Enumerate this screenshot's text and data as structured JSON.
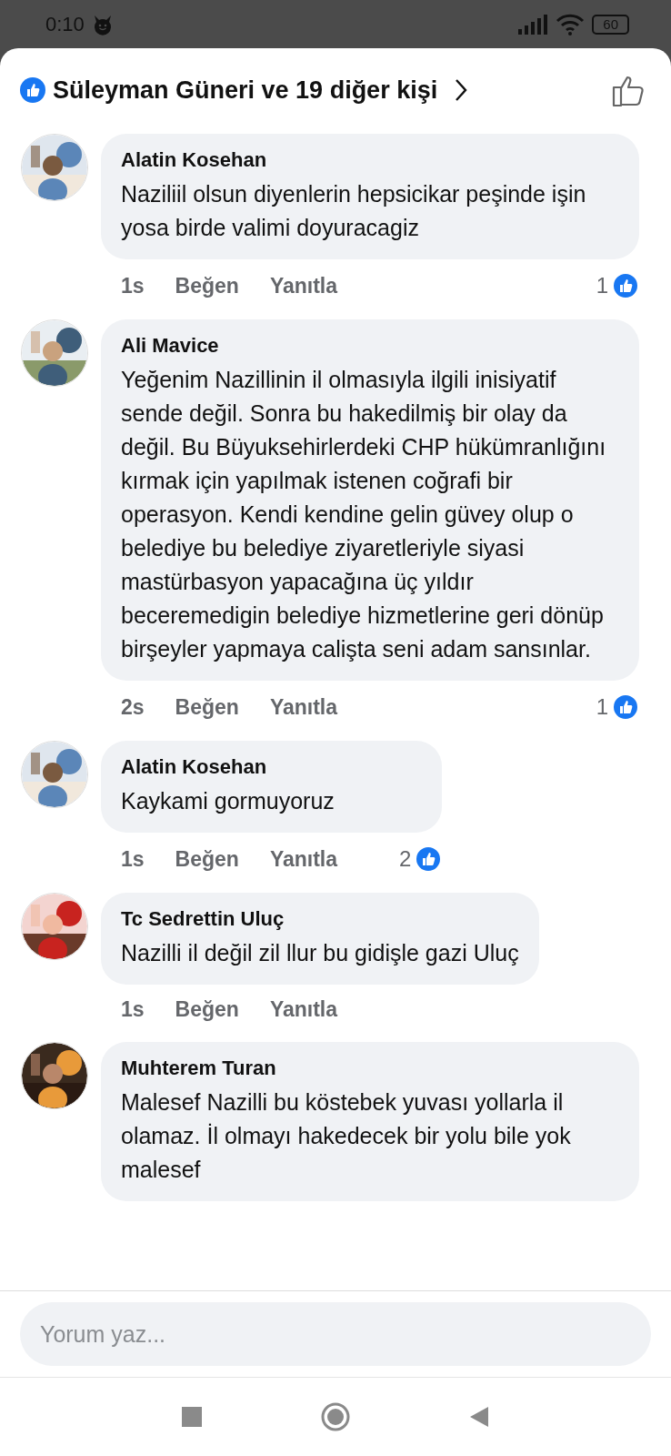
{
  "status_bar": {
    "time": "0:10",
    "battery": "60"
  },
  "header": {
    "title": "Süleyman Güneri ve 19 diğer kişi"
  },
  "comments": [
    {
      "author": "Alatin Kosehan",
      "text": "Naziliil olsun diyenlerin hepsicikar peşinde işin yosa birde valimi doyuracagiz",
      "time": "1s",
      "like_label": "Beğen",
      "reply_label": "Yanıtla",
      "likes": "1"
    },
    {
      "author": "Ali Mavice",
      "text": "Yeğenim Nazillinin il olmasıyla ilgili inisiyatif sende değil. Sonra bu hakedilmiş bir olay da değil. Bu Büyuksehirlerdeki CHP hükümranlığını kırmak için yapılmak istenen  coğrafi bir operasyon. Kendi kendine gelin güvey olup o belediye bu belediye ziyaretleriyle siyasi mastürbasyon yapacağına üç yıldır beceremedigin belediye hizmetlerine geri dönüp birşeyler yapmaya calişta seni adam sansınlar.",
      "time": "2s",
      "like_label": "Beğen",
      "reply_label": "Yanıtla",
      "likes": "1"
    },
    {
      "author": "Alatin Kosehan",
      "text": "Kaykami gormuyoruz",
      "time": "1s",
      "like_label": "Beğen",
      "reply_label": "Yanıtla",
      "likes": "2"
    },
    {
      "author": "Tc Sedrettin Uluç",
      "text": "Nazilli il değil zil llur bu gidişle gazi Uluç",
      "time": "1s",
      "like_label": "Beğen",
      "reply_label": "Yanıtla"
    },
    {
      "author": "Muhterem Turan",
      "text": "Malesef Nazilli bu köstebek yuvası yollarla il olamaz. İl olmayı hakedecek bir yolu bile yok malesef"
    }
  ],
  "composer": {
    "placeholder": "Yorum yaz..."
  }
}
